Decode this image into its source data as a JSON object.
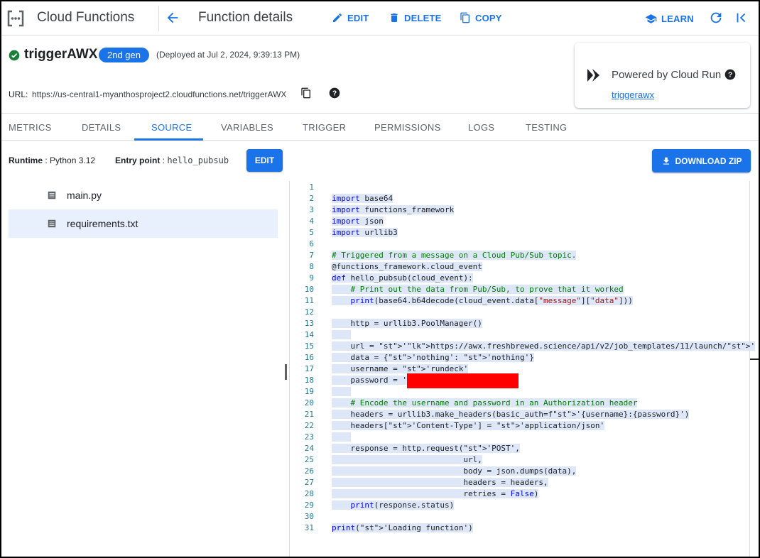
{
  "topbar": {
    "product_name": "Cloud Functions",
    "page_title": "Function details",
    "edit_label": "EDIT",
    "delete_label": "DELETE",
    "copy_label": "COPY",
    "learn_label": "LEARN"
  },
  "function": {
    "name": "triggerAWX",
    "generation": "2nd gen",
    "deployed": "(Deployed at Jul 2, 2024, 9:39:13 PM)",
    "url_label": "URL:",
    "url": "https://us-central1-myanthosproject2.cloudfunctions.net/triggerAWX"
  },
  "cloud_run": {
    "title": "Powered by Cloud Run",
    "link": "triggerawx"
  },
  "tabs": [
    "METRICS",
    "DETAILS",
    "SOURCE",
    "VARIABLES",
    "TRIGGER",
    "PERMISSIONS",
    "LOGS",
    "TESTING"
  ],
  "active_tab": "SOURCE",
  "source": {
    "runtime_label": "Runtime",
    "runtime_value": ": Python 3.12",
    "entry_label": "Entry point",
    "entry_value": "hello_pubsub",
    "edit_label": "EDIT",
    "download_label": "DOWNLOAD ZIP",
    "files": [
      "main.py",
      "requirements.txt"
    ],
    "selected_file": "requirements.txt"
  },
  "editor": {
    "line_numbers": [
      "1",
      "2",
      "3",
      "4",
      "5",
      "6",
      "7",
      "8",
      "9",
      "10",
      "11",
      "12",
      "13",
      "14",
      "15",
      "16",
      "17",
      "18",
      "19",
      "20",
      "21",
      "22",
      "23",
      "24",
      "25",
      "26",
      "27",
      "28",
      "29",
      "30",
      "31"
    ],
    "lines": [
      "",
      "import base64",
      "import functions_framework",
      "import json",
      "import urllib3",
      "",
      "# Triggered from a message on a Cloud Pub/Sub topic.",
      "@functions_framework.cloud_event",
      "def hello_pubsub(cloud_event):",
      "    # Print out the data from Pub/Sub, to prove that it worked",
      "    print(base64.b64decode(cloud_event.data[\"message\"][\"data\"]))",
      "",
      "    http = urllib3.PoolManager()",
      "    ",
      "    url = 'https://awx.freshbrewed.science/api/v2/job_templates/11/launch/'",
      "    data = {'nothing': 'nothing'}",
      "    username = 'rundeck'",
      "    password = '",
      "    ",
      "    # Encode the username and password in an Authorization header",
      "    headers = urllib3.make_headers(basic_auth=f'{username}:{password}')",
      "    headers['Content-Type'] = 'application/json'",
      "    ",
      "    response = http.request('POST',",
      "                            url,",
      "                            body = json.dumps(data),",
      "                            headers = headers,",
      "                            retries = False)",
      "    print(response.status)",
      "",
      "print('Loading function')"
    ]
  },
  "colors": {
    "accent": "#1a73e8",
    "success": "#188038",
    "redaction": "#ff0000"
  }
}
